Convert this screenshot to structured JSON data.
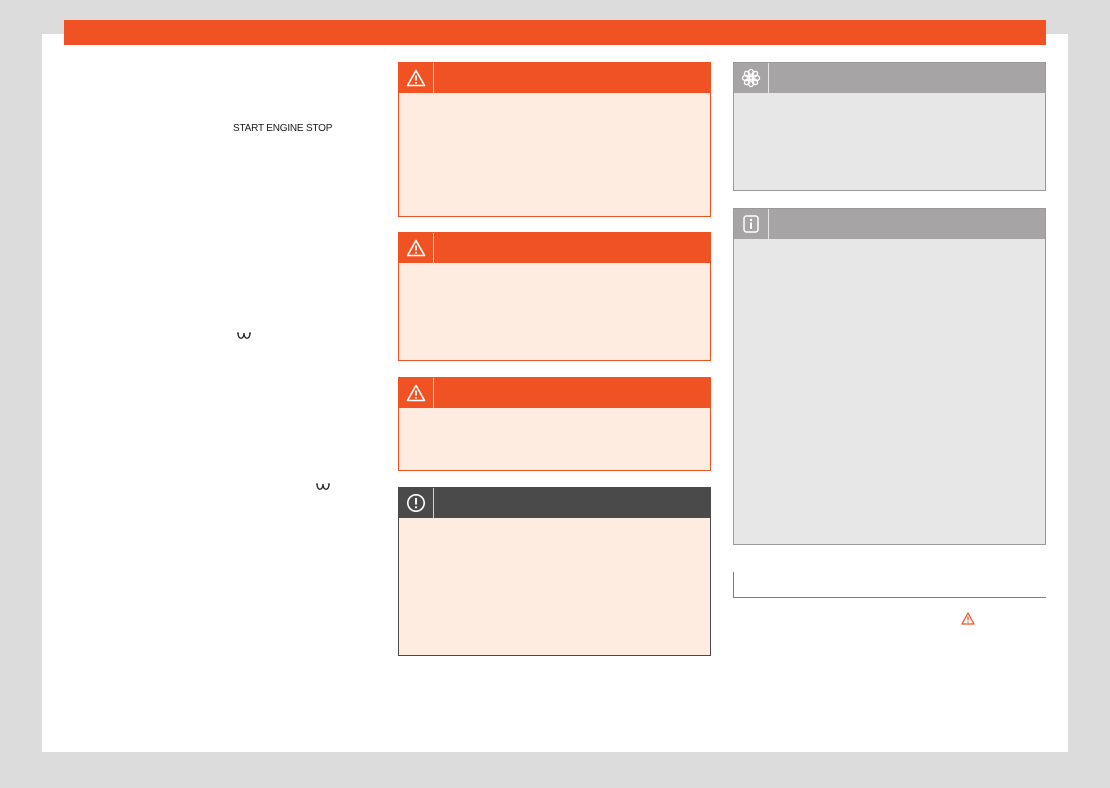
{
  "colors": {
    "accent": "#f15224",
    "warning_bg": "#fdecdf",
    "note_header": "#4b4a4a",
    "grey_header": "#a6a4a4",
    "grey_bg": "#e7e7e7"
  },
  "left_column": {
    "start_engine_stop_label": "START ENGINE STOP",
    "glow_plug_icon_1": "glow-plug-icon",
    "glow_plug_icon_2": "glow-plug-icon"
  },
  "boxes": [
    {
      "kind": "warning",
      "icon": "warning-triangle-icon"
    },
    {
      "kind": "warning",
      "icon": "warning-triangle-icon"
    },
    {
      "kind": "warning",
      "icon": "warning-triangle-icon"
    },
    {
      "kind": "note",
      "icon": "exclamation-circle-icon"
    },
    {
      "kind": "environment",
      "icon": "flower-icon"
    },
    {
      "kind": "info",
      "icon": "info-icon"
    }
  ],
  "section": {
    "warning_ref_icon": "warning-triangle-icon"
  }
}
